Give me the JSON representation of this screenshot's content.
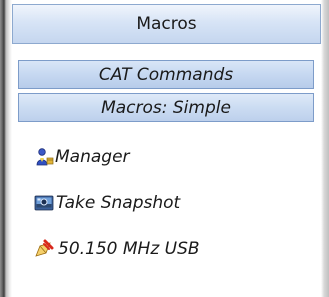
{
  "panel": {
    "title": "Macros"
  },
  "groups": [
    {
      "label": "CAT Commands"
    },
    {
      "label": "Macros: Simple"
    }
  ],
  "items": [
    {
      "label": "Manager",
      "icon": "manager-icon"
    },
    {
      "label": "Take Snapshot",
      "icon": "snapshot-icon"
    },
    {
      "label": "50.150 MHz USB",
      "icon": "frequency-macro-icon"
    }
  ],
  "colors": {
    "title_bar": "#d7e4f6",
    "group_button": "#c6d8f1",
    "border": "#7d9cc9"
  }
}
